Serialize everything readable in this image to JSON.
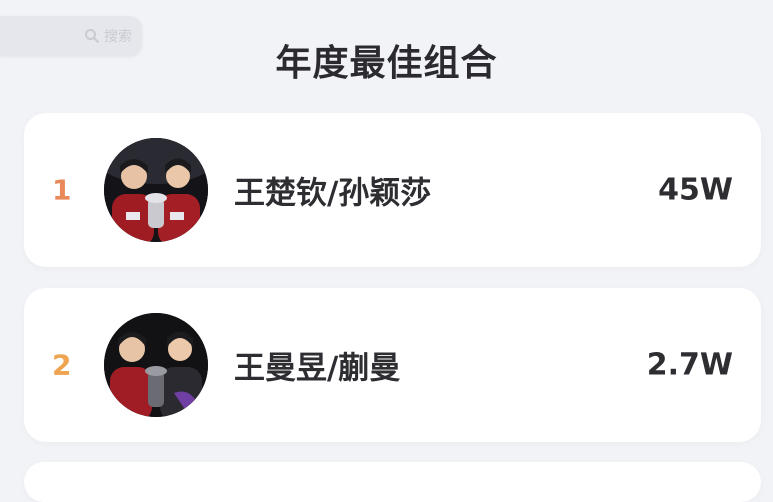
{
  "search": {
    "placeholder": "搜索",
    "icon": "search-icon"
  },
  "page": {
    "title": "年度最佳组合"
  },
  "colors": {
    "rank_1": "#e9895a",
    "rank_2": "#efa451",
    "background": "#f2f3f7",
    "card": "#ffffff"
  },
  "rows": [
    {
      "rank": "1",
      "name": "王楚钦/孙颖莎",
      "score": "45W"
    },
    {
      "rank": "2",
      "name": "王曼昱/蒯曼",
      "score": "2.7W"
    }
  ]
}
